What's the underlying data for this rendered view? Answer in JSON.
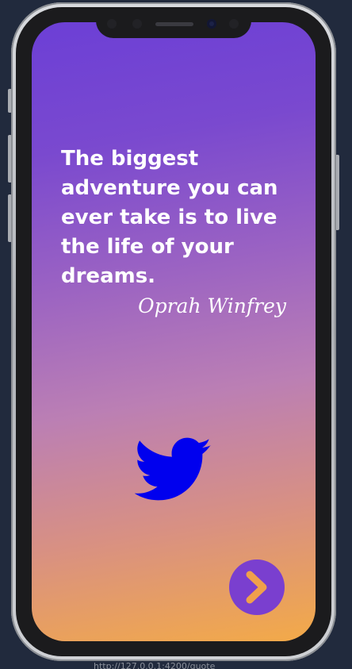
{
  "quote": {
    "text": "The biggest adventure you can ever take is to live the life of your dreams.",
    "author": "Oprah Winfrey"
  },
  "actions": {
    "tweet_icon": "twitter-icon",
    "next_icon": "chevron-right-icon"
  },
  "browser": {
    "url_fragment": "http://127.0.0.1:4200/quote"
  },
  "colors": {
    "gradient_top": "#6c3fd6",
    "gradient_bottom": "#f3aa48",
    "twitter_bird": "#0000ee",
    "next_button_bg": "#7a3fcf",
    "next_chevron": "#f0a04b"
  }
}
